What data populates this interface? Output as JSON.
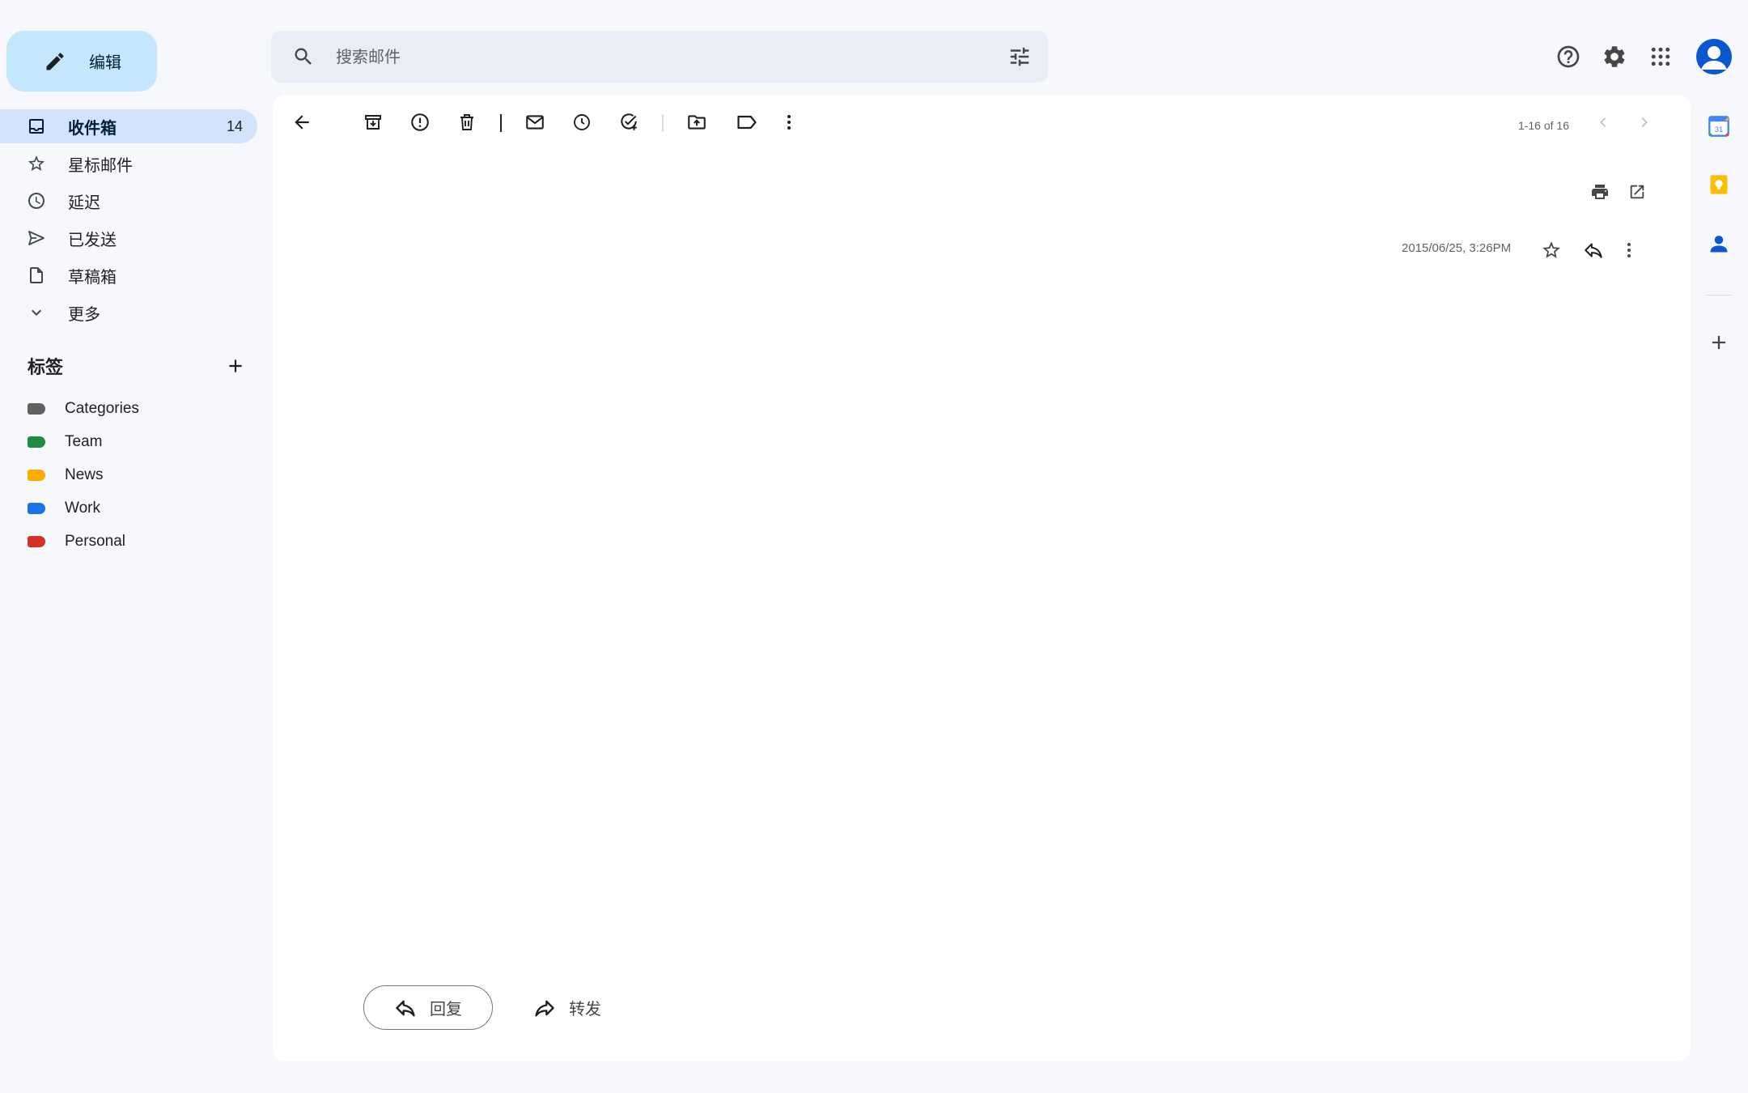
{
  "compose": {
    "label": "编辑"
  },
  "search": {
    "placeholder": "搜索邮件"
  },
  "sidebar": {
    "items": [
      {
        "label": "收件箱",
        "count": "14",
        "icon": "inbox-icon"
      },
      {
        "label": "星标邮件",
        "icon": "star-icon"
      },
      {
        "label": "延迟",
        "icon": "clock-icon"
      },
      {
        "label": "已发送",
        "icon": "send-icon"
      },
      {
        "label": "草稿箱",
        "icon": "draft-icon"
      },
      {
        "label": "更多",
        "icon": "chevron-down-icon"
      }
    ]
  },
  "labels": {
    "title": "标签",
    "items": [
      {
        "name": "Categories",
        "color": "#616161"
      },
      {
        "name": "Team",
        "color": "#1e8e3e"
      },
      {
        "name": "News",
        "color": "#f9ab00"
      },
      {
        "name": "Work",
        "color": "#1a73e8"
      },
      {
        "name": "Personal",
        "color": "#d93025"
      }
    ]
  },
  "toolbar": {
    "pager": "1-16 of 16"
  },
  "message": {
    "date": "2015/06/25, 3:26PM"
  },
  "actions": {
    "reply_label": "回复",
    "forward_label": "转发"
  },
  "colors": {
    "accent": "#0b57d0",
    "compose_bg": "#c2e7ff",
    "active_nav": "#d3e3fd"
  }
}
